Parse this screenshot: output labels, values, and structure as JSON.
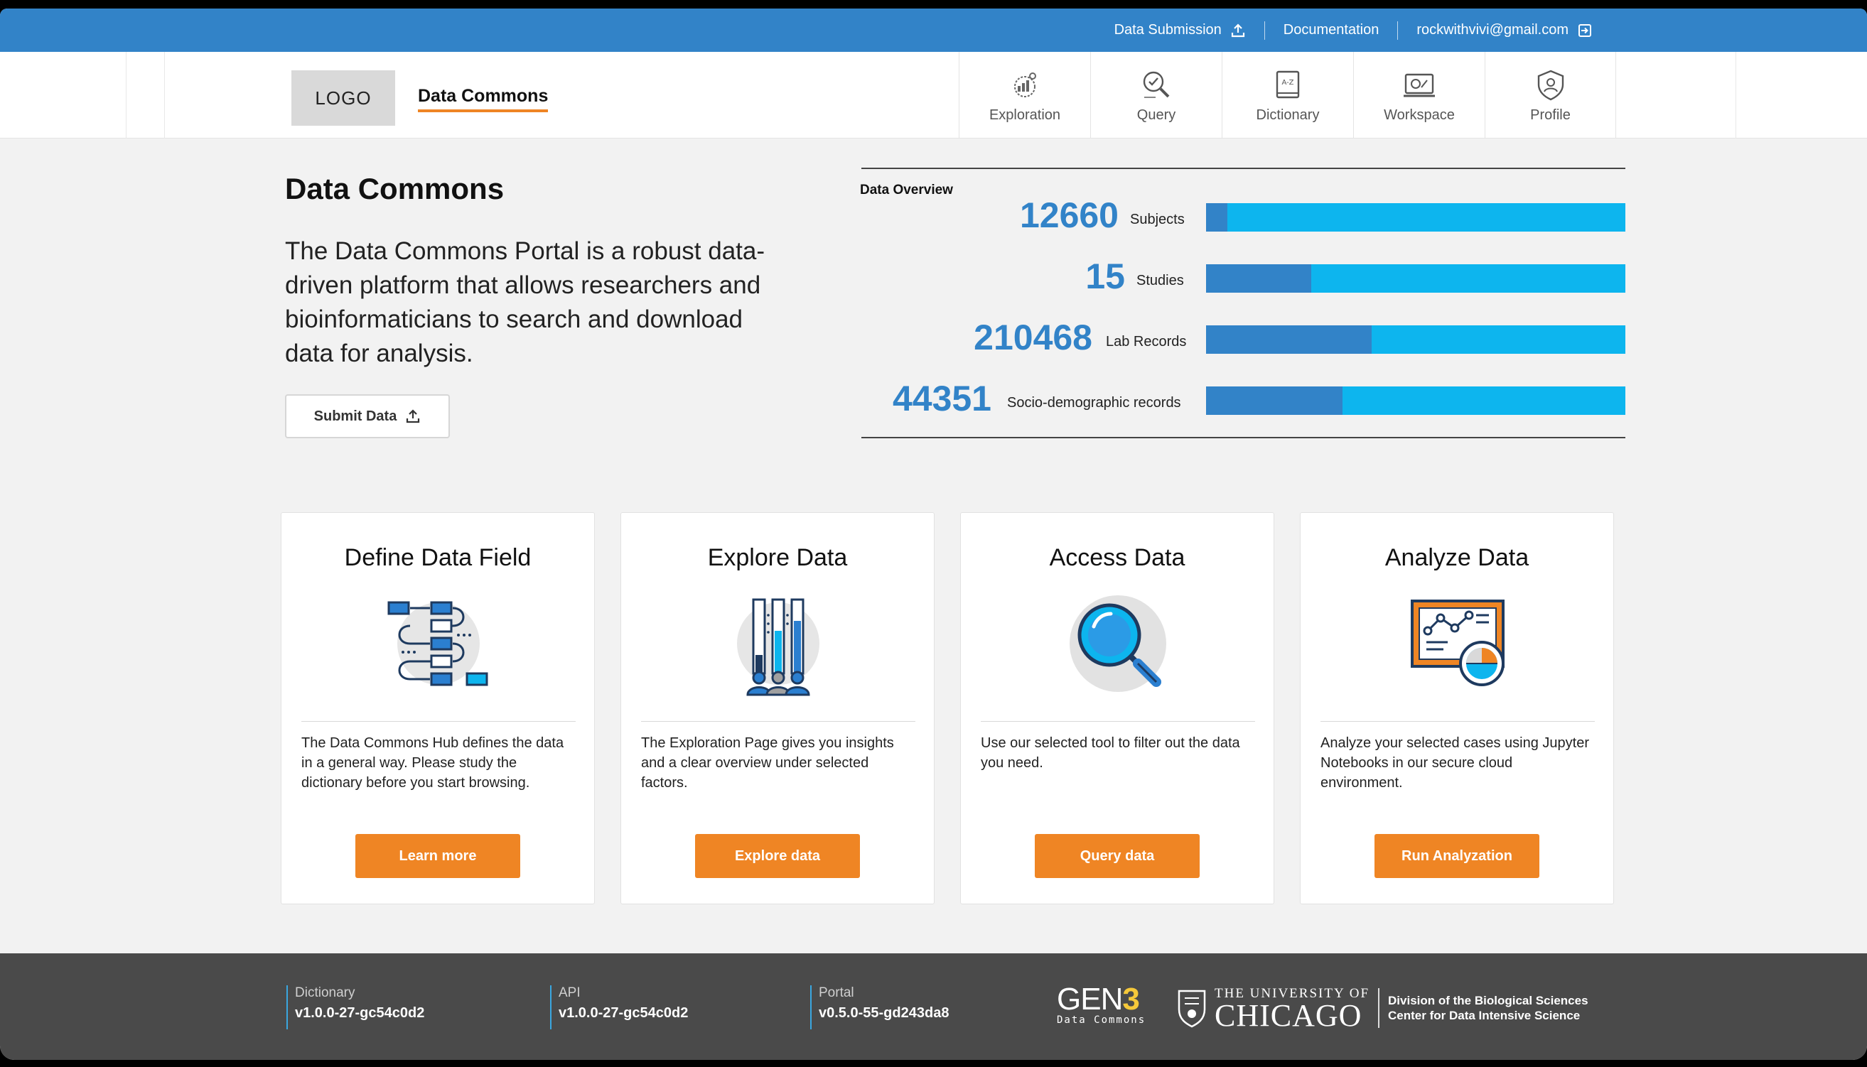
{
  "topbar": {
    "data_submission": "Data Submission",
    "documentation": "Documentation",
    "user_email": "rockwithvivi@gmail.com"
  },
  "navbar": {
    "logo": "LOGO",
    "brand": "Data Commons",
    "items": [
      {
        "label": "Exploration",
        "icon": "exploration-icon"
      },
      {
        "label": "Query",
        "icon": "query-icon"
      },
      {
        "label": "Dictionary",
        "icon": "dictionary-icon"
      },
      {
        "label": "Workspace",
        "icon": "workspace-icon"
      },
      {
        "label": "Profile",
        "icon": "profile-icon"
      }
    ]
  },
  "intro": {
    "title": "Data Commons",
    "text": "The Data Commons Portal is a robust data-driven platform that allows researchers and bioinformaticians to search and download data for analysis.",
    "submit_label": "Submit Data"
  },
  "overview": {
    "label": "Data Overview",
    "rows": [
      {
        "value": "12660",
        "name": "Subjects",
        "fraction": 0.05
      },
      {
        "value": "15",
        "name": "Studies",
        "fraction": 0.25
      },
      {
        "value": "210468",
        "name": "Lab Records",
        "fraction": 0.395
      },
      {
        "value": "44351",
        "name": "Socio-demographic records",
        "fraction": 0.325
      }
    ],
    "colors": {
      "fill": "#3283c8",
      "track": "#0db5ee"
    }
  },
  "cards": [
    {
      "title": "Define Data Field",
      "text": "The Data Commons Hub defines the data in a general way. Please study the dictionary before you start browsing.",
      "button": "Learn more"
    },
    {
      "title": "Explore Data",
      "text": "The Exploration Page gives you insights and a clear overview under selected factors.",
      "button": "Explore data"
    },
    {
      "title": "Access Data",
      "text": "Use our selected tool to filter out the data you need.",
      "button": "Query data"
    },
    {
      "title": "Analyze Data",
      "text": "Analyze your selected cases using Jupyter Notebooks in our secure cloud environment.",
      "button": "Run Analyzation"
    }
  ],
  "footer": {
    "versions": [
      {
        "key": "Dictionary",
        "value": "v1.0.0-27-gc54c0d2"
      },
      {
        "key": "API",
        "value": "v1.0.0-27-gc54c0d2"
      },
      {
        "key": "Portal",
        "value": "v0.5.0-55-gd243da8"
      }
    ],
    "gen3_big": "GEN",
    "gen3_num": "3",
    "gen3_small": "Data Commons",
    "uchicago_line1": "THE UNIVERSITY OF",
    "uchicago_line2": "CHICAGO",
    "division_line1": "Division of the Biological Sciences",
    "division_line2": "Center for Data Intensive Science"
  },
  "colors": {
    "accent": "#ef8524",
    "primary": "#3283c8",
    "cyan": "#0db5ee"
  }
}
